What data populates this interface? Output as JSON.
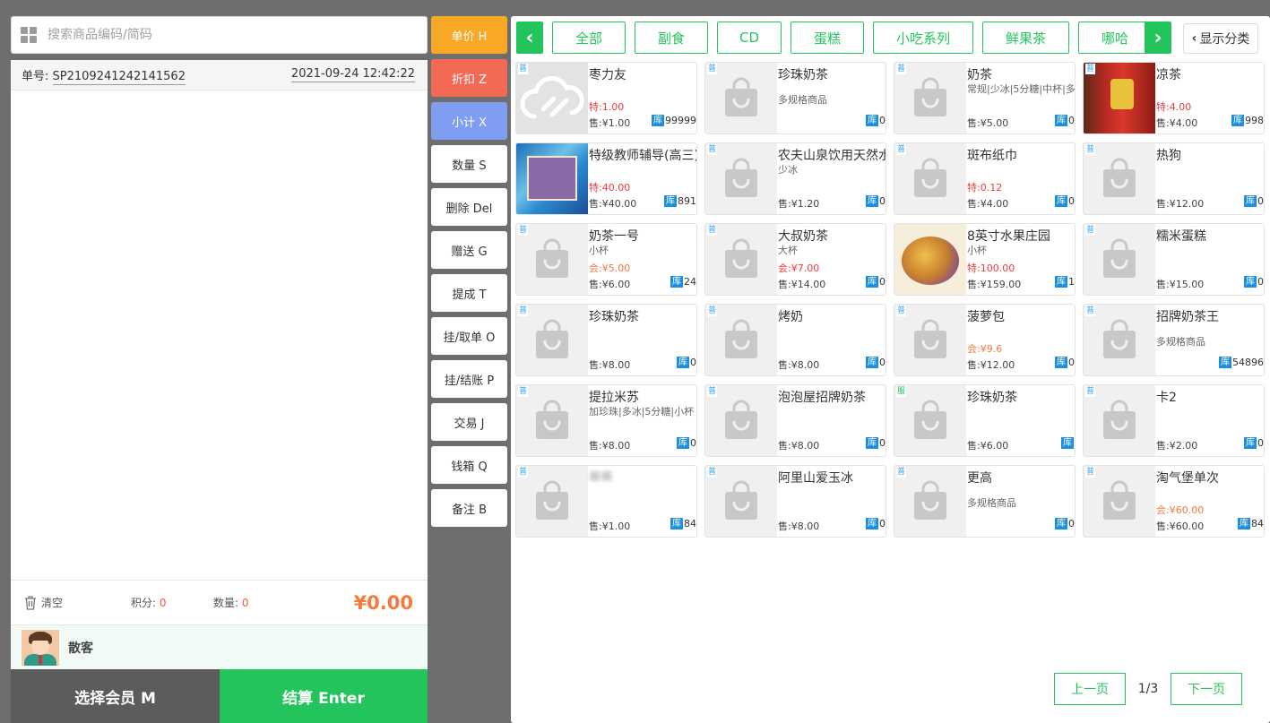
{
  "search": {
    "placeholder": "搜索商品编码/简码"
  },
  "order": {
    "no_label": "单号:",
    "no": "SP2109241242141562",
    "datetime": "2021-09-24 12:42:22"
  },
  "summary": {
    "clear_label": "清空",
    "points_label": "积分:",
    "points": "0",
    "qty_label": "数量:",
    "qty": "0",
    "total": "¥0.00"
  },
  "member": {
    "name": "散客"
  },
  "buttons": {
    "member": "选择会员 M",
    "pay": "结算 Enter"
  },
  "functions": [
    {
      "label": "单价 H",
      "style": "orange"
    },
    {
      "label": "折扣 Z",
      "style": "red"
    },
    {
      "label": "小计 X",
      "style": "blue"
    },
    {
      "label": "数量 S",
      "style": ""
    },
    {
      "label": "删除 Del",
      "style": ""
    },
    {
      "label": "赠送 G",
      "style": ""
    },
    {
      "label": "提成 T",
      "style": ""
    },
    {
      "label": "挂/取单 O",
      "style": ""
    },
    {
      "label": "挂/结账 P",
      "style": ""
    },
    {
      "label": "交易 J",
      "style": ""
    },
    {
      "label": "钱箱 Q",
      "style": ""
    },
    {
      "label": "备注 B",
      "style": ""
    }
  ],
  "categories": [
    {
      "label": "全部",
      "w": 82
    },
    {
      "label": "副食",
      "w": 82
    },
    {
      "label": "CD",
      "w": 72
    },
    {
      "label": "蛋糕",
      "w": 82
    },
    {
      "label": "小吃系列",
      "w": 112
    },
    {
      "label": "鲜果茶",
      "w": 97
    },
    {
      "label": "哪哈",
      "w": 82
    }
  ],
  "show_categories": "显示分类",
  "products": [
    {
      "tag": "普",
      "name": "枣力友",
      "sub": "",
      "special": "特:1.00",
      "special_color": "red",
      "sale": "售:¥1.00",
      "stock": "99999",
      "img": "cloud"
    },
    {
      "tag": "普",
      "name": "珍珠奶茶",
      "sub": "多规格商品",
      "special": "",
      "sale": "",
      "stock": "0",
      "img": "bag",
      "sub_low": true
    },
    {
      "tag": "普",
      "name": "奶茶",
      "sub": "常规|少冰|5分糖|中杯|多",
      "special": "",
      "sale": "售:¥5.00",
      "stock": "0",
      "img": "bag"
    },
    {
      "tag": "普",
      "name": "凉茶",
      "sub": "",
      "special": "特:4.00",
      "special_color": "red",
      "sale": "售:¥4.00",
      "stock": "998",
      "img": "can"
    },
    {
      "tag": "",
      "name": "特级教师辅导(高三)",
      "sub": "",
      "special": "特:40.00",
      "special_color": "red",
      "sale": "售:¥40.00",
      "stock": "891",
      "img": "book"
    },
    {
      "tag": "普",
      "name": "农夫山泉饮用天然水",
      "sub": "少冰",
      "special": "",
      "sale": "售:¥1.20",
      "stock": "0",
      "img": "bag"
    },
    {
      "tag": "普",
      "name": "斑布纸巾",
      "sub": "",
      "special": "特:0.12",
      "special_color": "red",
      "sale": "售:¥4.00",
      "stock": "0",
      "img": "bag"
    },
    {
      "tag": "普",
      "name": "热狗",
      "sub": "",
      "special": "",
      "sale": "售:¥12.00",
      "stock": "0",
      "img": "bag"
    },
    {
      "tag": "普",
      "name": "奶茶一号",
      "sub": "小杯",
      "special": "会:¥5.00",
      "special_color": "orange",
      "sale": "售:¥6.00",
      "stock": "24",
      "img": "bag"
    },
    {
      "tag": "普",
      "name": "大叔奶茶",
      "sub": "大杯",
      "special": "会:¥7.00",
      "special_color": "red",
      "sale": "售:¥14.00",
      "stock": "0",
      "img": "bag"
    },
    {
      "tag": "",
      "name": "8英寸水果庄园",
      "sub": "小杯",
      "special": "特:100.00",
      "special_color": "red",
      "sale": "售:¥159.00",
      "stock": "1",
      "img": "cake"
    },
    {
      "tag": "普",
      "name": "糯米蛋糕",
      "sub": "",
      "special": "",
      "sale": "售:¥15.00",
      "stock": "0",
      "img": "bag"
    },
    {
      "tag": "普",
      "name": "珍珠奶茶",
      "sub": "",
      "special": "",
      "sale": "售:¥8.00",
      "stock": "0",
      "img": "bag"
    },
    {
      "tag": "普",
      "name": "烤奶",
      "sub": "",
      "special": "",
      "sale": "售:¥8.00",
      "stock": "0",
      "img": "bag"
    },
    {
      "tag": "普",
      "name": "菠萝包",
      "sub": "",
      "special": "会:¥9.6",
      "special_color": "orange",
      "sale": "售:¥12.00",
      "stock": "0",
      "img": "bag"
    },
    {
      "tag": "普",
      "name": "招牌奶茶王",
      "sub": "多规格商品",
      "special": "",
      "sale": "",
      "stock": "54896",
      "img": "bag",
      "sub_low": true
    },
    {
      "tag": "普",
      "name": "提拉米苏",
      "sub": "加珍珠|多冰|5分糖|小杯",
      "special": "",
      "sale": "售:¥8.00",
      "stock": "0",
      "img": "bag"
    },
    {
      "tag": "普",
      "name": "泡泡屋招牌奶茶",
      "sub": "",
      "special": "",
      "sale": "售:¥8.00",
      "stock": "0",
      "img": "bag"
    },
    {
      "tag": "服",
      "name": "珍珠奶茶",
      "sub": "",
      "special": "",
      "sale": "售:¥6.00",
      "stock": "",
      "img": "bag",
      "tag_green": true
    },
    {
      "tag": "普",
      "name": "卡2",
      "sub": "",
      "special": "",
      "sale": "售:¥2.00",
      "stock": "0",
      "img": "bag"
    },
    {
      "tag": "普",
      "name": "",
      "sub": "",
      "special": "",
      "sale": "售:¥1.00",
      "stock": "84",
      "img": "bag",
      "blurred": true
    },
    {
      "tag": "普",
      "name": "阿里山爱玉冰",
      "sub": "",
      "special": "",
      "sale": "售:¥8.00",
      "stock": "0",
      "img": "bag"
    },
    {
      "tag": "普",
      "name": "更高",
      "sub": "多规格商品",
      "special": "",
      "sale": "",
      "stock": "0",
      "img": "bag",
      "sub_low": true
    },
    {
      "tag": "普",
      "name": "淘气堡单次",
      "sub": "",
      "special": "会:¥60.00",
      "special_color": "orange",
      "sale": "售:¥60.00",
      "stock": "84",
      "img": "bag"
    }
  ],
  "stock_label": "库",
  "pager": {
    "prev": "上一页",
    "page": "1/3",
    "next": "下一页"
  }
}
